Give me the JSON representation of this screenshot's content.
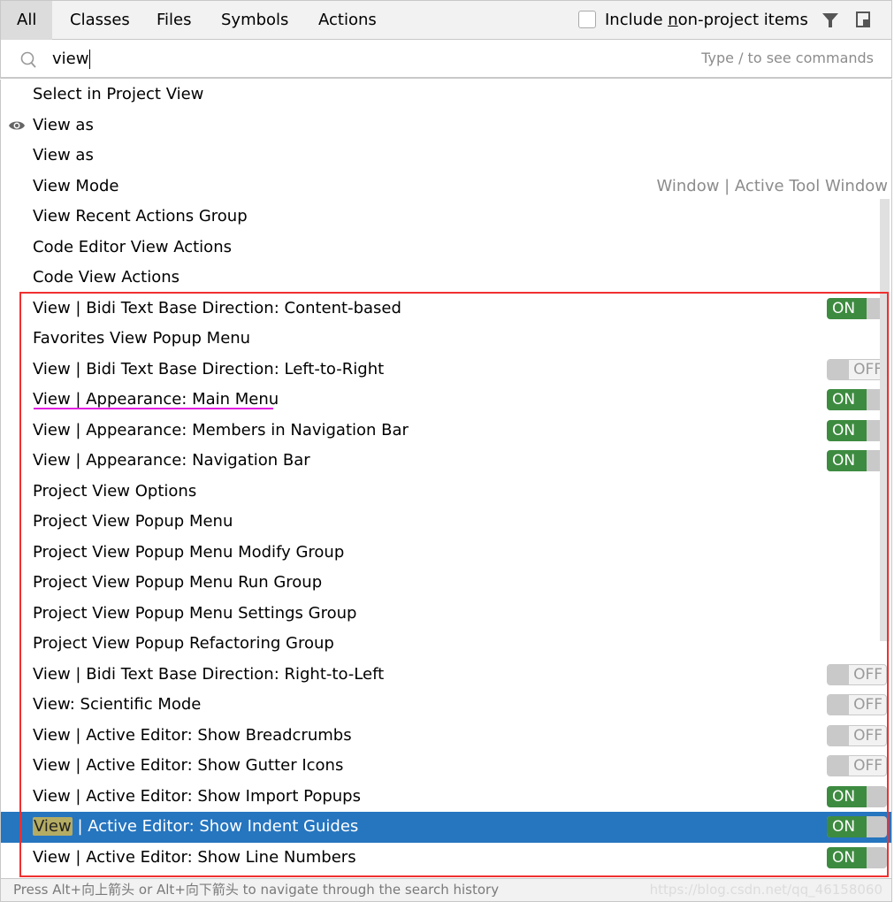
{
  "tabs": [
    {
      "label": "All",
      "active": true
    },
    {
      "label": "Classes",
      "active": false
    },
    {
      "label": "Files",
      "active": false
    },
    {
      "label": "Symbols",
      "active": false
    },
    {
      "label": "Actions",
      "active": false
    }
  ],
  "include_checkbox": {
    "label_pre": "Include ",
    "label_mnemonic": "n",
    "label_post": "on-project items",
    "checked": false
  },
  "toolbar_icons": [
    "filter-icon",
    "pin-window-icon"
  ],
  "search": {
    "value": "view",
    "hint": "Type / to see commands"
  },
  "rows": [
    {
      "label": "Select in Project View"
    },
    {
      "label": "View as",
      "icon": "eye-icon"
    },
    {
      "label": "View as"
    },
    {
      "label": "View Mode",
      "shortcut": "Window | Active Tool Window"
    },
    {
      "label": "View Recent Actions Group"
    },
    {
      "label": "Code Editor View Actions"
    },
    {
      "label": "Code View Actions"
    },
    {
      "label": "View | Bidi Text Base Direction: Content-based",
      "toggle": "ON"
    },
    {
      "label": "Favorites View Popup Menu"
    },
    {
      "label": "View | Bidi Text Base Direction: Left-to-Right",
      "toggle": "OFF"
    },
    {
      "label": "View | Appearance: Main Menu",
      "toggle": "ON"
    },
    {
      "label": "View | Appearance: Members in Navigation Bar",
      "toggle": "ON"
    },
    {
      "label": "View | Appearance: Navigation Bar",
      "toggle": "ON"
    },
    {
      "label": "Project View Options"
    },
    {
      "label": "Project View Popup Menu"
    },
    {
      "label": "Project View Popup Menu Modify Group"
    },
    {
      "label": "Project View Popup Menu Run Group"
    },
    {
      "label": "Project View Popup Menu Settings Group"
    },
    {
      "label": "Project View Popup Refactoring Group"
    },
    {
      "label": "View | Bidi Text Base Direction: Right-to-Left",
      "toggle": "OFF"
    },
    {
      "label": "View: Scientific Mode",
      "toggle": "OFF"
    },
    {
      "label": "View | Active Editor: Show Breadcrumbs",
      "toggle": "OFF"
    },
    {
      "label": "View | Active Editor: Show Gutter Icons",
      "toggle": "OFF"
    },
    {
      "label": "View | Active Editor: Show Import Popups",
      "toggle": "ON"
    },
    {
      "label": "View | Active Editor: Show Indent Guides",
      "toggle": "ON",
      "selected": true,
      "highlight": "View",
      "rest": " | Active Editor: Show Indent Guides"
    },
    {
      "label": "View | Active Editor: Show Line Numbers",
      "toggle": "ON"
    }
  ],
  "footer": {
    "text": "Press Alt+向上箭头 or Alt+向下箭头 to navigate through the search history"
  },
  "watermark": "https://blog.csdn.net/qq_46158060",
  "colors": {
    "selection": "#2675bf",
    "toggle_on": "#3d8b40",
    "annotation_box": "#f03030",
    "annotation_underline": "#e020e0",
    "match_highlight": "#b5ac63"
  }
}
